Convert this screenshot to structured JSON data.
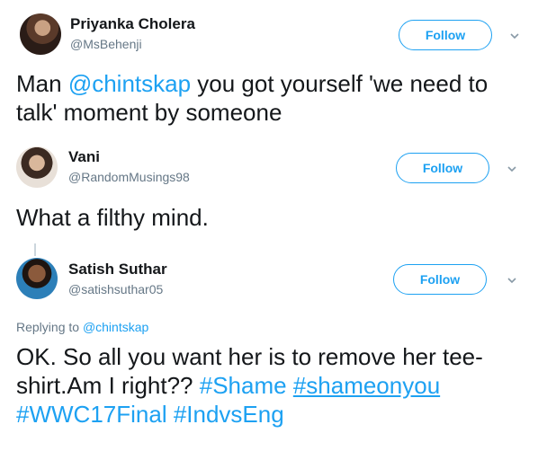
{
  "tweets": [
    {
      "name": "Priyanka Cholera",
      "handle": "@MsBehenji",
      "follow_label": "Follow",
      "text_parts": [
        {
          "t": "Man ",
          "link": false
        },
        {
          "t": "@chintskap",
          "link": true
        },
        {
          "t": " you got yourself 'we need to talk'  moment by someone",
          "link": false
        }
      ]
    },
    {
      "name": "Vani",
      "handle": "@RandomMusings98",
      "follow_label": "Follow",
      "text_parts": [
        {
          "t": "What a filthy mind.",
          "link": false
        }
      ]
    },
    {
      "name": "Satish Suthar",
      "handle": "@satishsuthar05",
      "follow_label": "Follow",
      "replying_prefix": "Replying to ",
      "replying_to": "@chintskap",
      "text_parts": [
        {
          "t": "OK. So all you want her is to remove her tee-shirt.Am I right?? ",
          "link": false
        },
        {
          "t": "#Shame",
          "link": true
        },
        {
          "t": " ",
          "link": false
        },
        {
          "t": "#shameonyou",
          "link": true,
          "underline": true
        },
        {
          "t": " ",
          "link": false
        },
        {
          "t": "#WWC17Final",
          "link": true
        },
        {
          "t": " ",
          "link": false
        },
        {
          "t": "#IndvsEng",
          "link": true
        }
      ]
    }
  ],
  "icons": {
    "more": "chevron-down-icon",
    "avatar": "avatar"
  },
  "colors": {
    "accent": "#1da1f2",
    "text": "#14171a",
    "muted": "#657786"
  }
}
